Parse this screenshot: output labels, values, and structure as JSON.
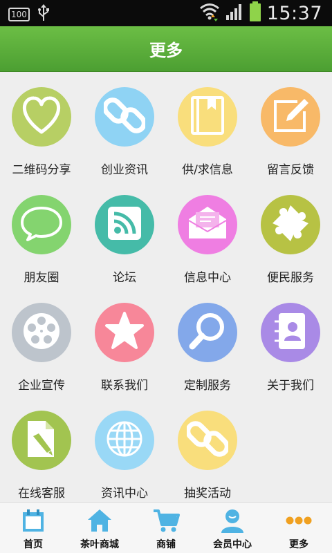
{
  "status_bar": {
    "battery_percent": "100",
    "time": "15:37"
  },
  "header": {
    "title": "更多"
  },
  "grid": [
    {
      "label": "二维码分享",
      "icon": "heart-icon",
      "color": "#b7cf64"
    },
    {
      "label": "创业资讯",
      "icon": "link-icon",
      "color": "#8fd3f4"
    },
    {
      "label": "供/求信息",
      "icon": "book-icon",
      "color": "#f9de7c"
    },
    {
      "label": "留言反馈",
      "icon": "edit-icon",
      "color": "#f8b968"
    },
    {
      "label": "朋友圈",
      "icon": "chat-bubble-icon",
      "color": "#84d46f"
    },
    {
      "label": "论坛",
      "icon": "rss-icon",
      "color": "#45bba8"
    },
    {
      "label": "信息中心",
      "icon": "envelope-icon",
      "color": "#ef7ee2"
    },
    {
      "label": "便民服务",
      "icon": "puzzle-icon",
      "color": "#b7c244"
    },
    {
      "label": "企业宣传",
      "icon": "film-reel-icon",
      "color": "#bdc4cc"
    },
    {
      "label": "联系我们",
      "icon": "star-icon",
      "color": "#f78799"
    },
    {
      "label": "定制服务",
      "icon": "search-icon",
      "color": "#83a8ea"
    },
    {
      "label": "关于我们",
      "icon": "contacts-book-icon",
      "color": "#a98ae6"
    },
    {
      "label": "在线客服",
      "icon": "document-pencil-icon",
      "color": "#a2c450"
    },
    {
      "label": "资讯中心",
      "icon": "globe-icon",
      "color": "#99d8f6"
    },
    {
      "label": "抽奖活动",
      "icon": "link-icon",
      "color": "#f9de7c"
    }
  ],
  "tabs": [
    {
      "label": "首页",
      "icon": "calendar-icon"
    },
    {
      "label": "茶叶商城",
      "icon": "house-icon"
    },
    {
      "label": "商铺",
      "icon": "cart-icon"
    },
    {
      "label": "会员中心",
      "icon": "user-icon"
    },
    {
      "label": "更多",
      "icon": "more-dots-icon"
    }
  ]
}
